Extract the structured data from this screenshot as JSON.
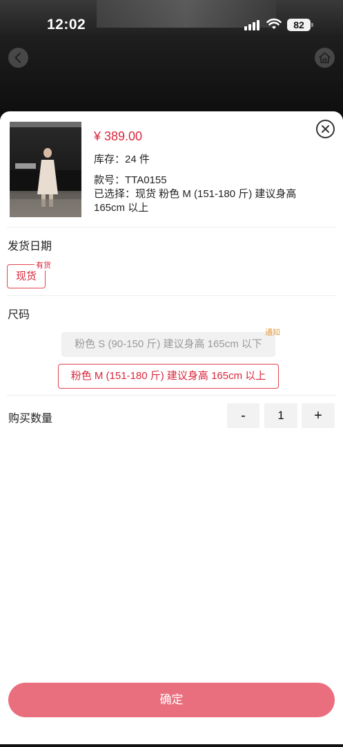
{
  "status_bar": {
    "time": "12:02",
    "battery": "82"
  },
  "icons": {
    "back": "chevron-left-icon",
    "home": "home-icon",
    "close": "close-icon",
    "signal": "signal-icon",
    "wifi": "wifi-icon"
  },
  "colors": {
    "accent": "#d9263b",
    "confirm_bg": "#e96f7e",
    "notify": "#e79a3d"
  },
  "product": {
    "price": "¥ 389.00",
    "stock": "库存：24 件",
    "model": "款号：TTA0155",
    "selected": "已选择：现货  粉色 M (151-180 斤) 建议身高 165cm 以上"
  },
  "ship_date": {
    "title": "发货日期",
    "option": "现货",
    "badge": "有货"
  },
  "size": {
    "title": "尺码",
    "options": [
      {
        "label": "粉色 S (90-150 斤) 建议身高 165cm 以下",
        "badge": "通知",
        "state": "disabled"
      },
      {
        "label": "粉色 M (151-180 斤) 建议身高 165cm 以上",
        "state": "selected"
      }
    ]
  },
  "quantity": {
    "label": "购买数量",
    "minus": "-",
    "value": "1",
    "plus": "+"
  },
  "confirm_label": "确定"
}
